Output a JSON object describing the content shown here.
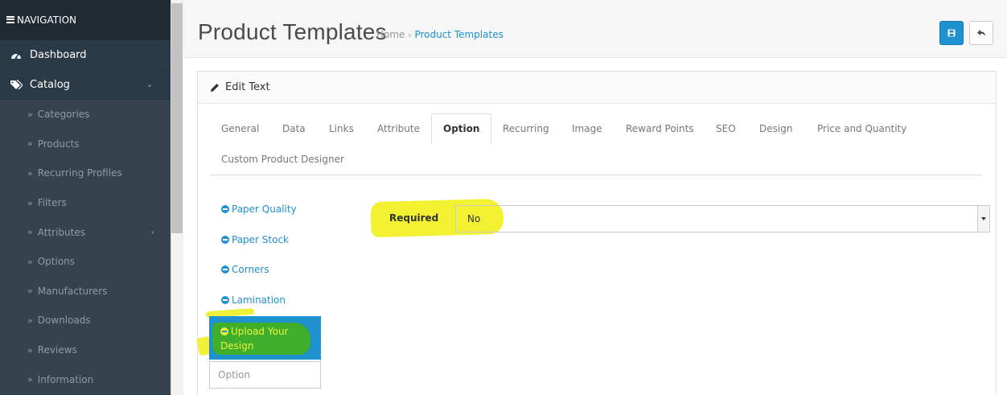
{
  "sidebar": {
    "header": "NAVIGATION",
    "items": [
      {
        "label": "Dashboard",
        "icon": "dashboard-icon"
      },
      {
        "label": "Catalog",
        "icon": "tags-icon",
        "expanded": true
      }
    ],
    "catalog_subitems": [
      {
        "label": "Categories"
      },
      {
        "label": "Products"
      },
      {
        "label": "Recurring Profiles"
      },
      {
        "label": "Filters"
      },
      {
        "label": "Attributes",
        "has_children": true
      },
      {
        "label": "Options"
      },
      {
        "label": "Manufacturers"
      },
      {
        "label": "Downloads"
      },
      {
        "label": "Reviews"
      },
      {
        "label": "Information"
      }
    ]
  },
  "header": {
    "title": "Product Templates",
    "breadcrumb": [
      "Home",
      "Product Templates"
    ]
  },
  "panel": {
    "title": "Edit Text",
    "tabs": [
      {
        "label": "General"
      },
      {
        "label": "Data"
      },
      {
        "label": "Links"
      },
      {
        "label": "Attribute"
      },
      {
        "label": "Option",
        "active": true
      },
      {
        "label": "Recurring"
      },
      {
        "label": "Image"
      },
      {
        "label": "Reward Points"
      },
      {
        "label": "SEO"
      },
      {
        "label": "Design"
      },
      {
        "label": "Price and Quantity"
      },
      {
        "label": "Custom Product Designer"
      }
    ],
    "options": [
      {
        "label": "Paper Quality"
      },
      {
        "label": "Paper Stock"
      },
      {
        "label": "Corners"
      },
      {
        "label": "Lamination"
      }
    ],
    "active_option": {
      "label_line1": "Upload Your",
      "label_line2": "Design"
    },
    "option_input_placeholder": "Option",
    "required_label": "Required",
    "required_value": "No"
  },
  "colors": {
    "sidebar_bg": "#2b3a47",
    "submenu_bg": "#36424d",
    "accent": "#1e91cf",
    "highlight_yellow": "#f2f232",
    "highlight_green": "#3fae2a"
  }
}
